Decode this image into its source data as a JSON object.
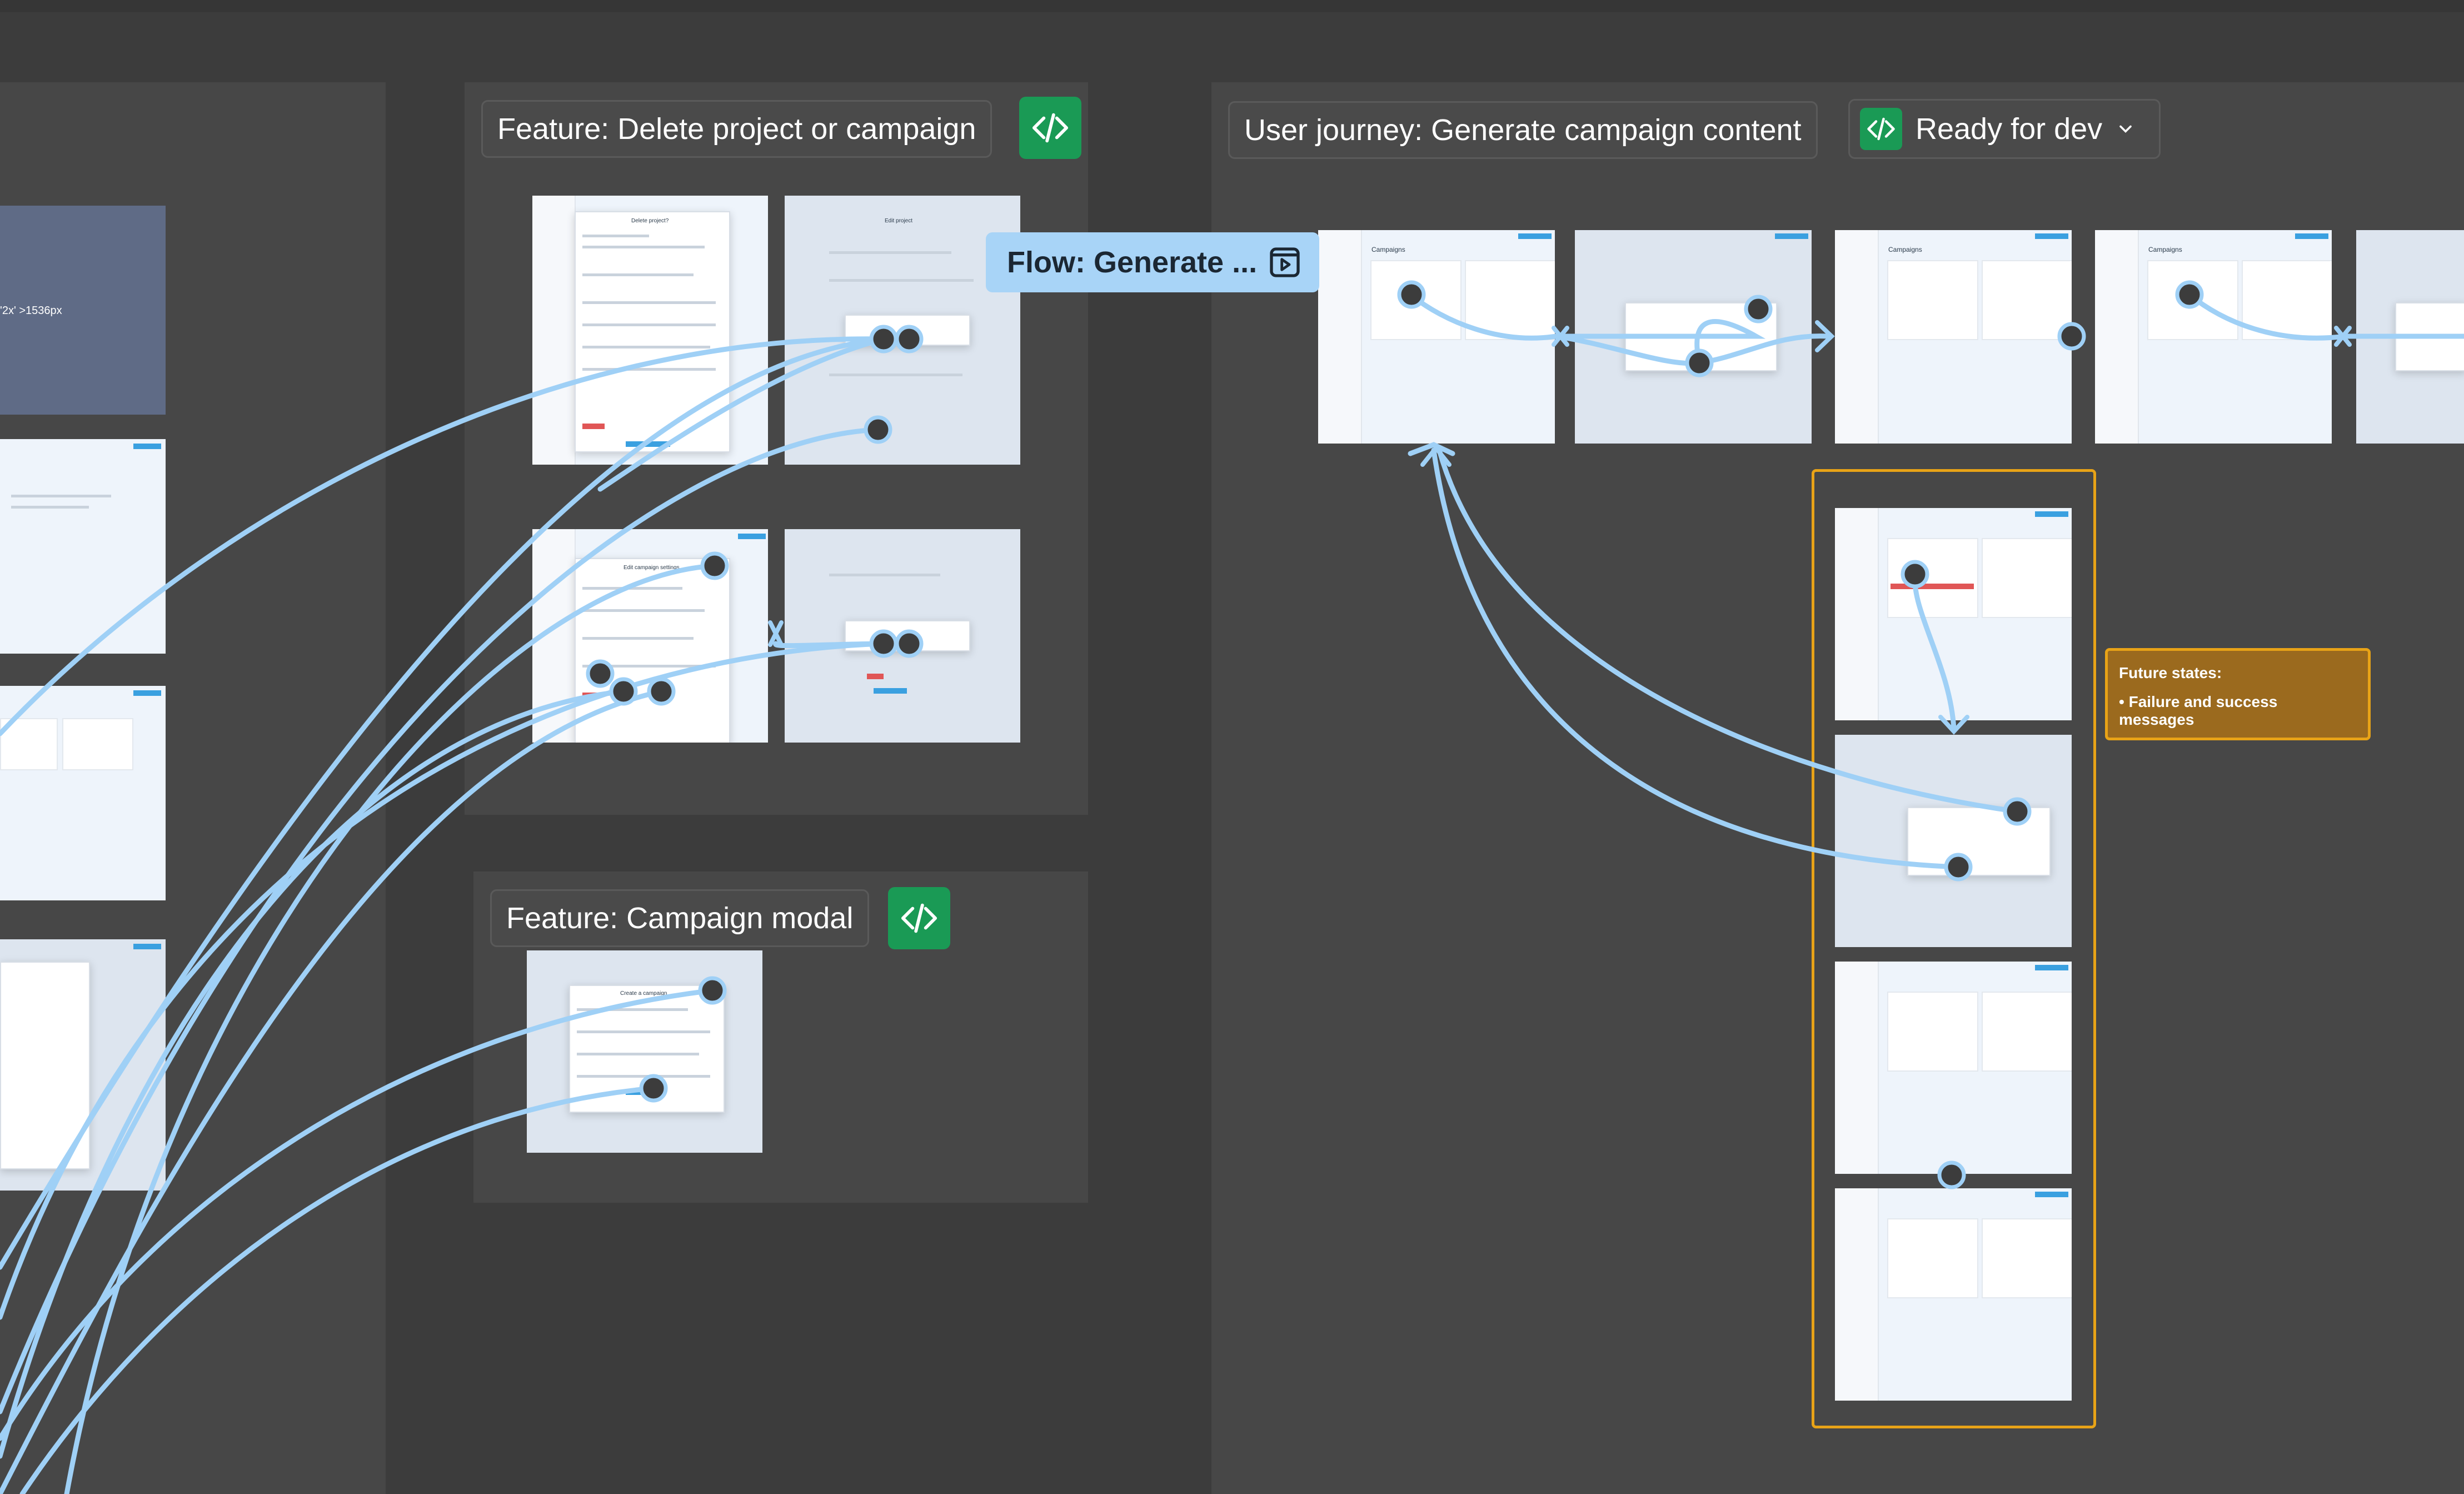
{
  "sections": {
    "delete_feature": {
      "title": "Feature: Delete project or campaign"
    },
    "campaign_modal": {
      "title": "Feature: Campaign modal"
    },
    "journey": {
      "title": "User journey: Generate campaign content",
      "status": "Ready for dev"
    }
  },
  "flow": {
    "label": "Flow: Generate ..."
  },
  "left_frame_text": "'2x' >1536px",
  "frame_titles": {
    "del1": "Delete project?",
    "del2": "Edit project",
    "edit": "Edit campaign settings",
    "campaigns": "Campaigns",
    "modal": "Create a campaign"
  },
  "note": {
    "title": "Future states:",
    "bullet": "Failure and success messages"
  },
  "icons": {
    "dev": "code-icon",
    "status": "code-icon",
    "chevron": "chevron-down-icon",
    "flow": "play-frame-icon"
  },
  "colors": {
    "canvas": "#3c3c3c",
    "section": "#474747",
    "dev_green": "#1a9a55",
    "flow_blue": "#a8d4f7",
    "wire": "#9fd0f6",
    "future_border": "#e8a317",
    "note_fill": "#9b6a1e"
  }
}
